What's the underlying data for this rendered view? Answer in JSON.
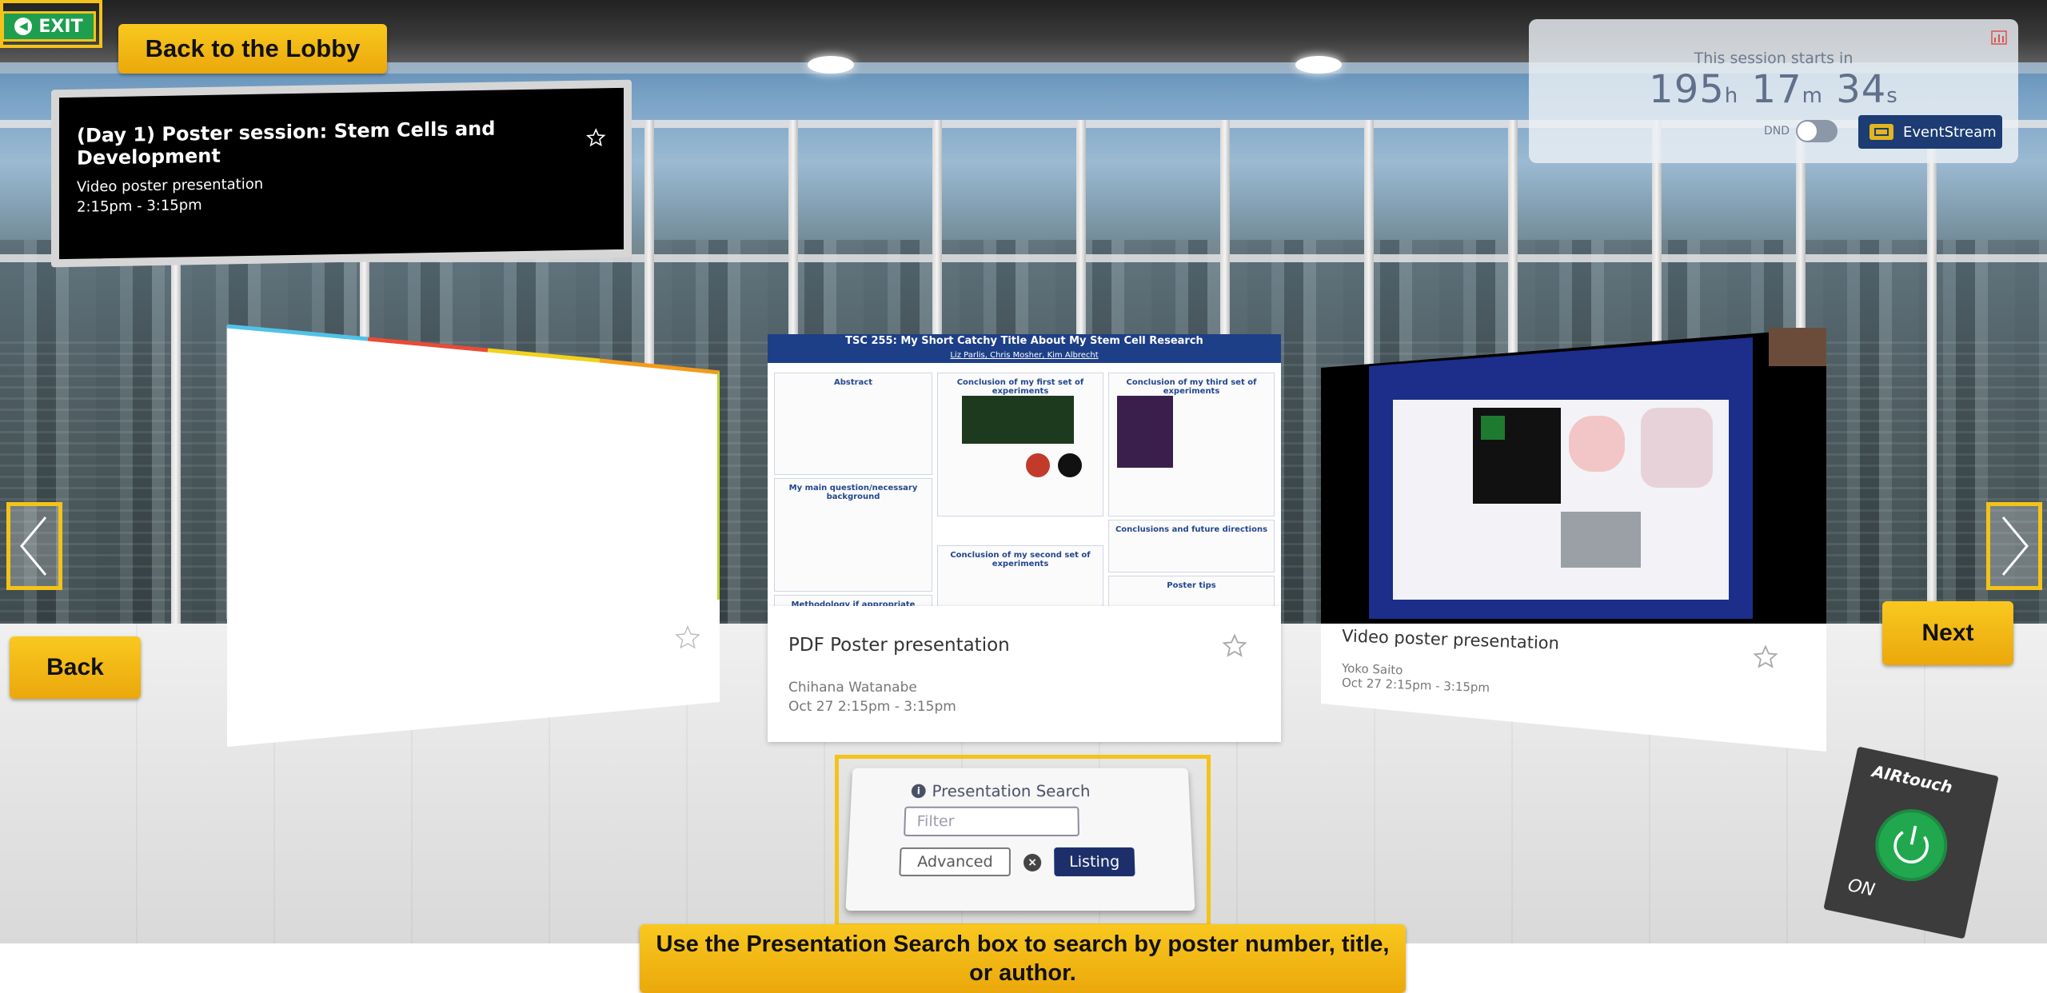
{
  "nav": {
    "exit_label": "EXIT",
    "back_to_lobby": "Back to the Lobby",
    "back": "Back",
    "next": "Next"
  },
  "session": {
    "title": "(Day 1) Poster session: Stem Cells and Development",
    "type": "Video poster presentation",
    "time": "2:15pm - 3:15pm"
  },
  "countdown": {
    "label": "This session starts in",
    "hours": "195",
    "hours_unit": "h",
    "minutes": "17",
    "minutes_unit": "m",
    "seconds": "34",
    "seconds_unit": "s",
    "dnd_label": "DND",
    "dnd_on": false,
    "stream_label": "EventStream"
  },
  "posters": [
    {
      "title": "",
      "author": "",
      "date": ""
    },
    {
      "title": "PDF Poster presentation",
      "author": "Chihana Watanabe",
      "date": "Oct 27 2:15pm - 3:15pm",
      "poster_heading": "TSC 255: My Short Catchy Title About My Stem Cell Research",
      "poster_authors": "Liz Parlis, Chris Mosher, Kim Albrecht",
      "panels": [
        "Abstract",
        "Conclusion of my first set of experiments",
        "Conclusion of my third set of experiments",
        "My main question/necessary background",
        "Conclusions and future directions",
        "Conclusion of my second set of experiments",
        "Methodology if appropriate",
        "Poster tips"
      ]
    },
    {
      "title": "Video poster presentation",
      "author": "Yoko Saito",
      "date": "Oct 27 2:15pm - 3:15pm"
    }
  ],
  "search": {
    "title": "Presentation Search",
    "filter_placeholder": "Filter",
    "advanced_label": "Advanced",
    "listing_label": "Listing",
    "tip": "Use the Presentation Search box to search by poster number, title, or author."
  },
  "airtouch": {
    "label": "AIRtouch",
    "state": "ON"
  },
  "colors": {
    "tip_yellow": "#f4c31a",
    "exit_green": "#1e9e4e",
    "navy": "#1d2f6b",
    "power_green": "#21a84f"
  }
}
